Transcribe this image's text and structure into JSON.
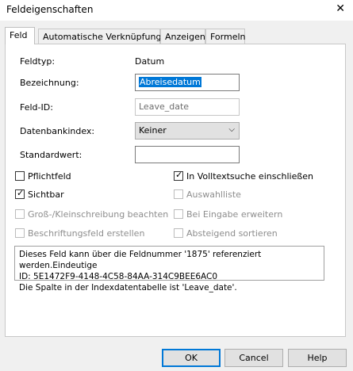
{
  "window": {
    "title": "Feldeigenschaften",
    "close_glyph": "✕"
  },
  "tabs": [
    {
      "label": "Feld"
    },
    {
      "label": "Automatische Verknüpfungen"
    },
    {
      "label": "Anzeigen"
    },
    {
      "label": "Formeln"
    }
  ],
  "fields": {
    "feldtyp_label": "Feldtyp:",
    "feldtyp_value": "Datum",
    "bezeichnung_label": "Bezeichnung:",
    "bezeichnung_value": "Abreisedatum",
    "feldid_label": "Feld-ID:",
    "feldid_value": "Leave_date",
    "datenbankindex_label": "Datenbankindex:",
    "datenbankindex_value": "Keiner",
    "standardwert_label": "Standardwert:",
    "standardwert_value": ""
  },
  "checkboxes": {
    "pflichtfeld": {
      "label": "Pflichtfeld",
      "checked": false
    },
    "volltext": {
      "label": "In Volltextsuche einschließen",
      "checked": true
    },
    "sichtbar": {
      "label": "Sichtbar",
      "checked": true
    },
    "auswahlliste": {
      "label": "Auswahlliste",
      "checked": false
    },
    "gross_klein": {
      "label": "Groß-/Kleinschreibung beachten",
      "checked": false
    },
    "eingabe_erweitern": {
      "label": "Bei Eingabe erweitern",
      "checked": false
    },
    "beschriftungsfeld": {
      "label": "Beschriftungsfeld erstellen",
      "checked": false
    },
    "absteigend": {
      "label": "Absteigend sortieren",
      "checked": false
    }
  },
  "info": {
    "line1": "Dieses Feld kann über die Feldnummer '1875' referenziert werden.Eindeutige",
    "line2": "ID: 5E1472F9-4148-4C58-84AA-314C9BEE6AC0",
    "line3": "Die Spalte in der Indexdatentabelle ist 'Leave_date'."
  },
  "buttons": {
    "ok": "OK",
    "cancel": "Cancel",
    "help": "Help"
  }
}
